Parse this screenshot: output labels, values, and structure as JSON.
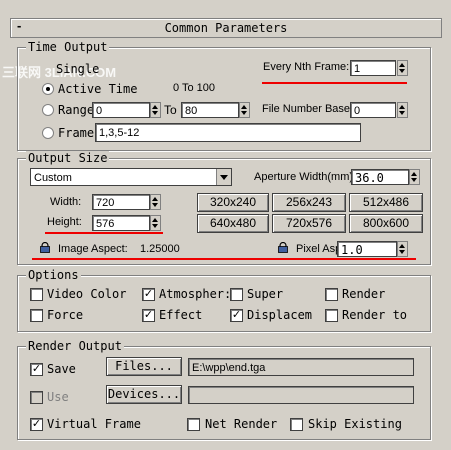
{
  "header": {
    "title": "Common Parameters",
    "collapse": "-"
  },
  "watermark": "三联网 3LIAN.COM",
  "time_output": {
    "group_title": "Time Output",
    "single_label": "Single",
    "every_nth_label": "Every Nth Frame:",
    "every_nth_value": "1",
    "active_time_label": "Active Time",
    "active_time_range": "0 To 100",
    "range_label": "Range:",
    "range_from": "0",
    "range_to_label": "To",
    "range_to": "80",
    "file_number_base_label": "File Number Base:",
    "file_number_base_value": "0",
    "frames_label": "Frames",
    "frames_value": "1,3,5-12"
  },
  "output_size": {
    "group_title": "Output Size",
    "preset": "Custom",
    "aperture_label": "Aperture Width(mm):",
    "aperture_value": "36.0",
    "width_label": "Width:",
    "width_value": "720",
    "height_label": "Height:",
    "height_value": "576",
    "presets": [
      "320x240",
      "256x243",
      "512x486",
      "640x480",
      "720x576",
      "800x600"
    ],
    "image_aspect_label": "Image Aspect:",
    "image_aspect_value": "1.25000",
    "pixel_aspect_label": "Pixel Aspect:",
    "pixel_aspect_value": "1.0"
  },
  "options": {
    "group_title": "Options",
    "items": [
      "Video Color",
      "Atmospher:",
      "Super",
      "Render",
      "Force",
      "Effect",
      "Displacem",
      "Render to"
    ],
    "checked": [
      false,
      true,
      false,
      false,
      false,
      true,
      true,
      false
    ]
  },
  "render_output": {
    "group_title": "Render Output",
    "save_label": "Save",
    "files_button": "Files...",
    "file_path": "E:\\wpp\\end.tga",
    "use_label": "Use",
    "devices_button": "Devices...",
    "virtual_frame_label": "Virtual Frame",
    "net_render_label": "Net Render",
    "skip_existing_label": "Skip Existing"
  },
  "colors": {
    "annotation": "#e00000",
    "panel": "#d4d0c8"
  }
}
